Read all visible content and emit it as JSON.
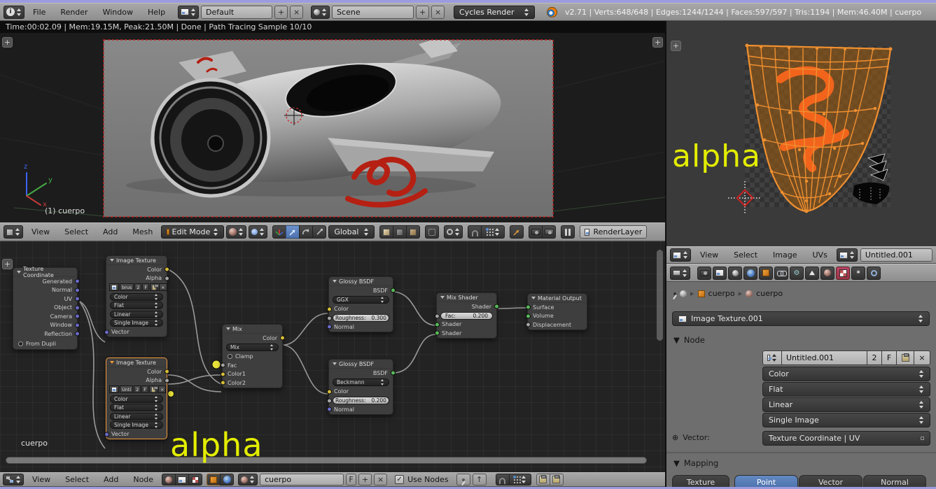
{
  "glyphs": {
    "plus": "+",
    "close": "×",
    "check": "✓",
    "collapse": "▼",
    "crumb": "▸",
    "expand": "⊕",
    "dot": "·"
  },
  "topbar": {
    "menus": [
      "File",
      "Render",
      "Window",
      "Help"
    ],
    "layout_name": "Default",
    "scene_name": "Scene",
    "engine": "Cycles Render",
    "stats": "v2.71 | Verts:648/648 | Edges:1244/1244 | Faces:597/597 | Tris:1194 | Mem:46.40M | cuerpo"
  },
  "status": "Time:00:02.09 | Mem:19.15M, Peak:21.50M | Done | Path Tracing Sample 10/10",
  "viewport": {
    "object_label": "(1) cuerpo",
    "axis": {
      "x": "x",
      "y": "y",
      "z": "z"
    },
    "header": {
      "menus": [
        "View",
        "Select",
        "Add",
        "Mesh"
      ],
      "mode": "Edit Mode",
      "orientation": "Global",
      "render_layer": "RenderLayer"
    }
  },
  "nodes": {
    "tex_coord": {
      "title": "Texture Coordinate",
      "outputs": [
        "Generated",
        "Normal",
        "UV",
        "Object",
        "Camera",
        "Window",
        "Reflection"
      ],
      "option": "From Dupli"
    },
    "img1": {
      "title": "Image Texture",
      "out1": "Color",
      "out2": "Alpha",
      "img": "brus",
      "users": "2",
      "fake": "F",
      "dd": [
        "Color",
        "Flat",
        "Linear",
        "Single Image"
      ],
      "input": "Vector"
    },
    "img2": {
      "title": "Image Texture",
      "out1": "Color",
      "out2": "Alpha",
      "img": "Unti",
      "users": "2",
      "fake": "F",
      "dd": [
        "Color",
        "Flat",
        "Linear",
        "Single Image"
      ],
      "input": "Vector"
    },
    "mix": {
      "title": "Mix",
      "out": "Color",
      "blend": "Mix",
      "clamp": "Clamp",
      "in1": "Fac",
      "in2": "Color1",
      "in3": "Color2"
    },
    "glossy1": {
      "title": "Glossy BSDF",
      "out": "BSDF",
      "dist": "GGX",
      "in1": "Color",
      "rough": "Roughness:",
      "rough_v": "0.300",
      "in3": "Normal"
    },
    "glossy2": {
      "title": "Glossy BSDF",
      "out": "BSDF",
      "dist": "Beckmann",
      "in1": "Color",
      "rough": "Roughness:",
      "rough_v": "0.200",
      "in3": "Normal"
    },
    "mix_shader": {
      "title": "Mix Shader",
      "out": "Shader",
      "fac": "Fac:",
      "fac_v": "0.200",
      "in2": "Shader",
      "in3": "Shader"
    },
    "mat_out": {
      "title": "Material Output",
      "in1": "Surface",
      "in2": "Volume",
      "in3": "Displacement"
    }
  },
  "node_editor": {
    "info": "cuerpo",
    "annotation": "alpha",
    "footer": {
      "menus": [
        "View",
        "Select",
        "Add",
        "Node"
      ],
      "material": "cuerpo",
      "fake": "F",
      "use_nodes": "Use Nodes"
    }
  },
  "uv_editor": {
    "annotation": "alpha",
    "header": {
      "menus": [
        "View",
        "Select",
        "Image",
        "UVs"
      ],
      "image": "Untitled.001"
    }
  },
  "props": {
    "breadcrumb": {
      "object": "cuerpo",
      "material": "cuerpo"
    },
    "texture": "Image Texture.001",
    "node_panel": {
      "title": "Node",
      "image": "Untitled.001",
      "users": "2",
      "fake": "F",
      "dd": [
        "Color",
        "Flat",
        "Linear",
        "Single Image"
      ],
      "vector_label": "Vector:",
      "vector_value": "Texture Coordinate | UV"
    },
    "mapping": {
      "title": "Mapping",
      "tabs": [
        "Texture",
        "Point",
        "Vector",
        "Normal"
      ],
      "active_tab": "Point"
    }
  },
  "colors": {
    "active_blue": "#5680c2",
    "select_orange": "#f09a3c",
    "annotation_yellow": "#e3ed00",
    "decal_red": "#b52013",
    "uv_orange": "#f09030"
  }
}
